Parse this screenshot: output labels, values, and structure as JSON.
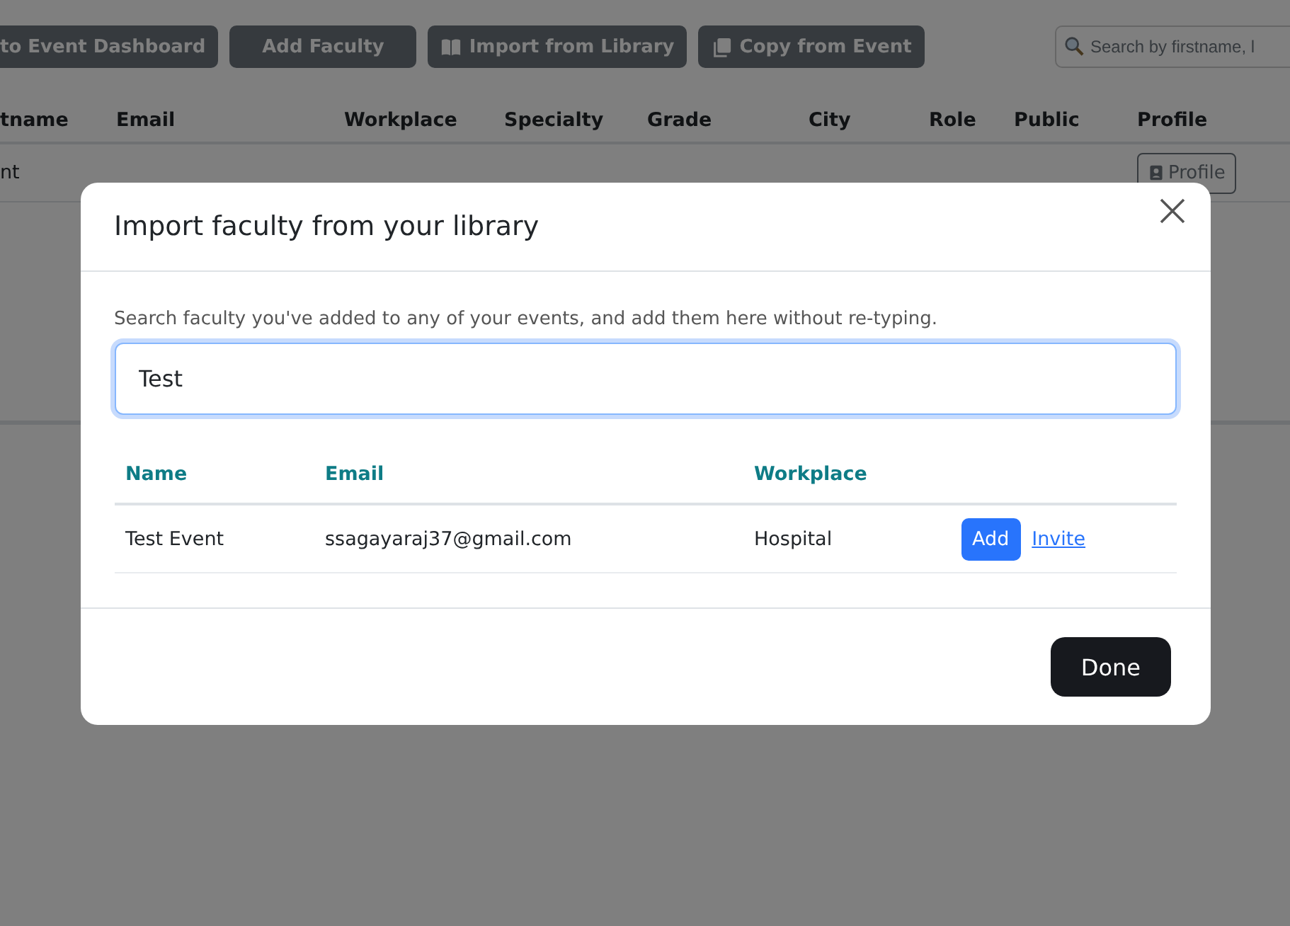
{
  "toolbar": {
    "buttons": [
      {
        "label": "to Event Dashboard"
      },
      {
        "label": "Add Faculty"
      },
      {
        "label": "Import from Library"
      },
      {
        "label": "Copy from Event"
      }
    ],
    "search": {
      "placeholder": "Search by firstname, l"
    }
  },
  "faculty_table": {
    "columns": [
      "tname",
      "Email",
      "Workplace",
      "Specialty",
      "Grade",
      "City",
      "Role",
      "Public",
      "Profile"
    ],
    "rows": [
      {
        "name": "nt",
        "profile_button": "Profile"
      }
    ]
  },
  "modal": {
    "title": "Import faculty from your library",
    "description": "Search faculty you've added to any of your events, and add them here without re-typing.",
    "search": {
      "value": "Test"
    },
    "columns": [
      "Name",
      "Email",
      "Workplace"
    ],
    "results": [
      {
        "name": "Test Event",
        "email": "ssagayaraj37@gmail.com",
        "workplace": "Hospital",
        "add_label": "Add",
        "invite_label": "Invite"
      }
    ],
    "done_label": "Done"
  }
}
